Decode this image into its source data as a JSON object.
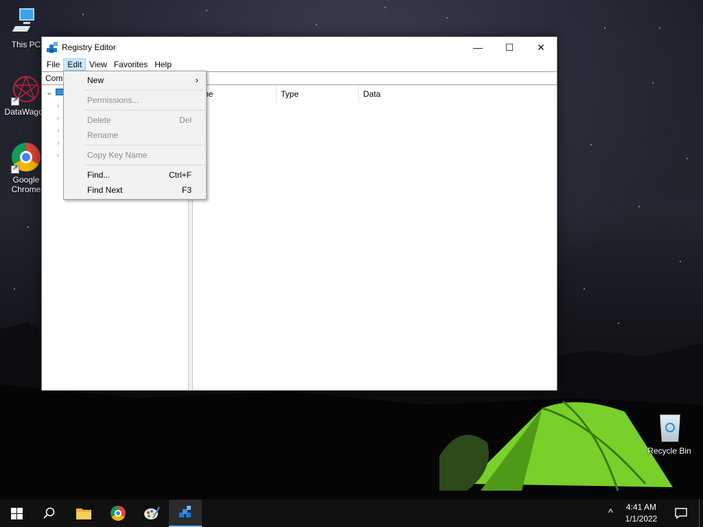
{
  "desktop": {
    "icons": [
      {
        "label": "This PC",
        "icon": "computer-icon"
      },
      {
        "label": "DataWagon",
        "icon": "datawagon-icon"
      },
      {
        "label": "Google Chrome",
        "icon": "chrome-icon"
      },
      {
        "label": "Recycle Bin",
        "icon": "recycle-bin-icon"
      }
    ]
  },
  "window": {
    "title": "Registry Editor",
    "buttons": {
      "minimize": "—",
      "maximize": "☐",
      "close": "✕"
    },
    "menubar": [
      "File",
      "Edit",
      "View",
      "Favorites",
      "Help"
    ],
    "active_menu": "Edit",
    "address": "Com",
    "list_columns": [
      "ame",
      "Type",
      "Data"
    ]
  },
  "edit_menu": {
    "items": [
      {
        "label": "New",
        "shortcut": "",
        "submenu": true,
        "disabled": false
      },
      {
        "label": "Permissions...",
        "shortcut": "",
        "submenu": false,
        "disabled": true
      },
      {
        "label": "Delete",
        "shortcut": "Del",
        "submenu": false,
        "disabled": true
      },
      {
        "label": "Rename",
        "shortcut": "",
        "submenu": false,
        "disabled": true
      },
      {
        "label": "Copy Key Name",
        "shortcut": "",
        "submenu": false,
        "disabled": true
      },
      {
        "label": "Find...",
        "shortcut": "Ctrl+F",
        "submenu": false,
        "disabled": false
      },
      {
        "label": "Find Next",
        "shortcut": "F3",
        "submenu": false,
        "disabled": false
      }
    ],
    "submenu_arrow": "›"
  },
  "taskbar": {
    "time": "4:41 AM",
    "date": "1/1/2022",
    "tray_chevron": "^"
  },
  "colors": {
    "accent": "#1a7bd8",
    "menu_highlight": "#cce8ff",
    "tent_green": "#7fd428"
  }
}
